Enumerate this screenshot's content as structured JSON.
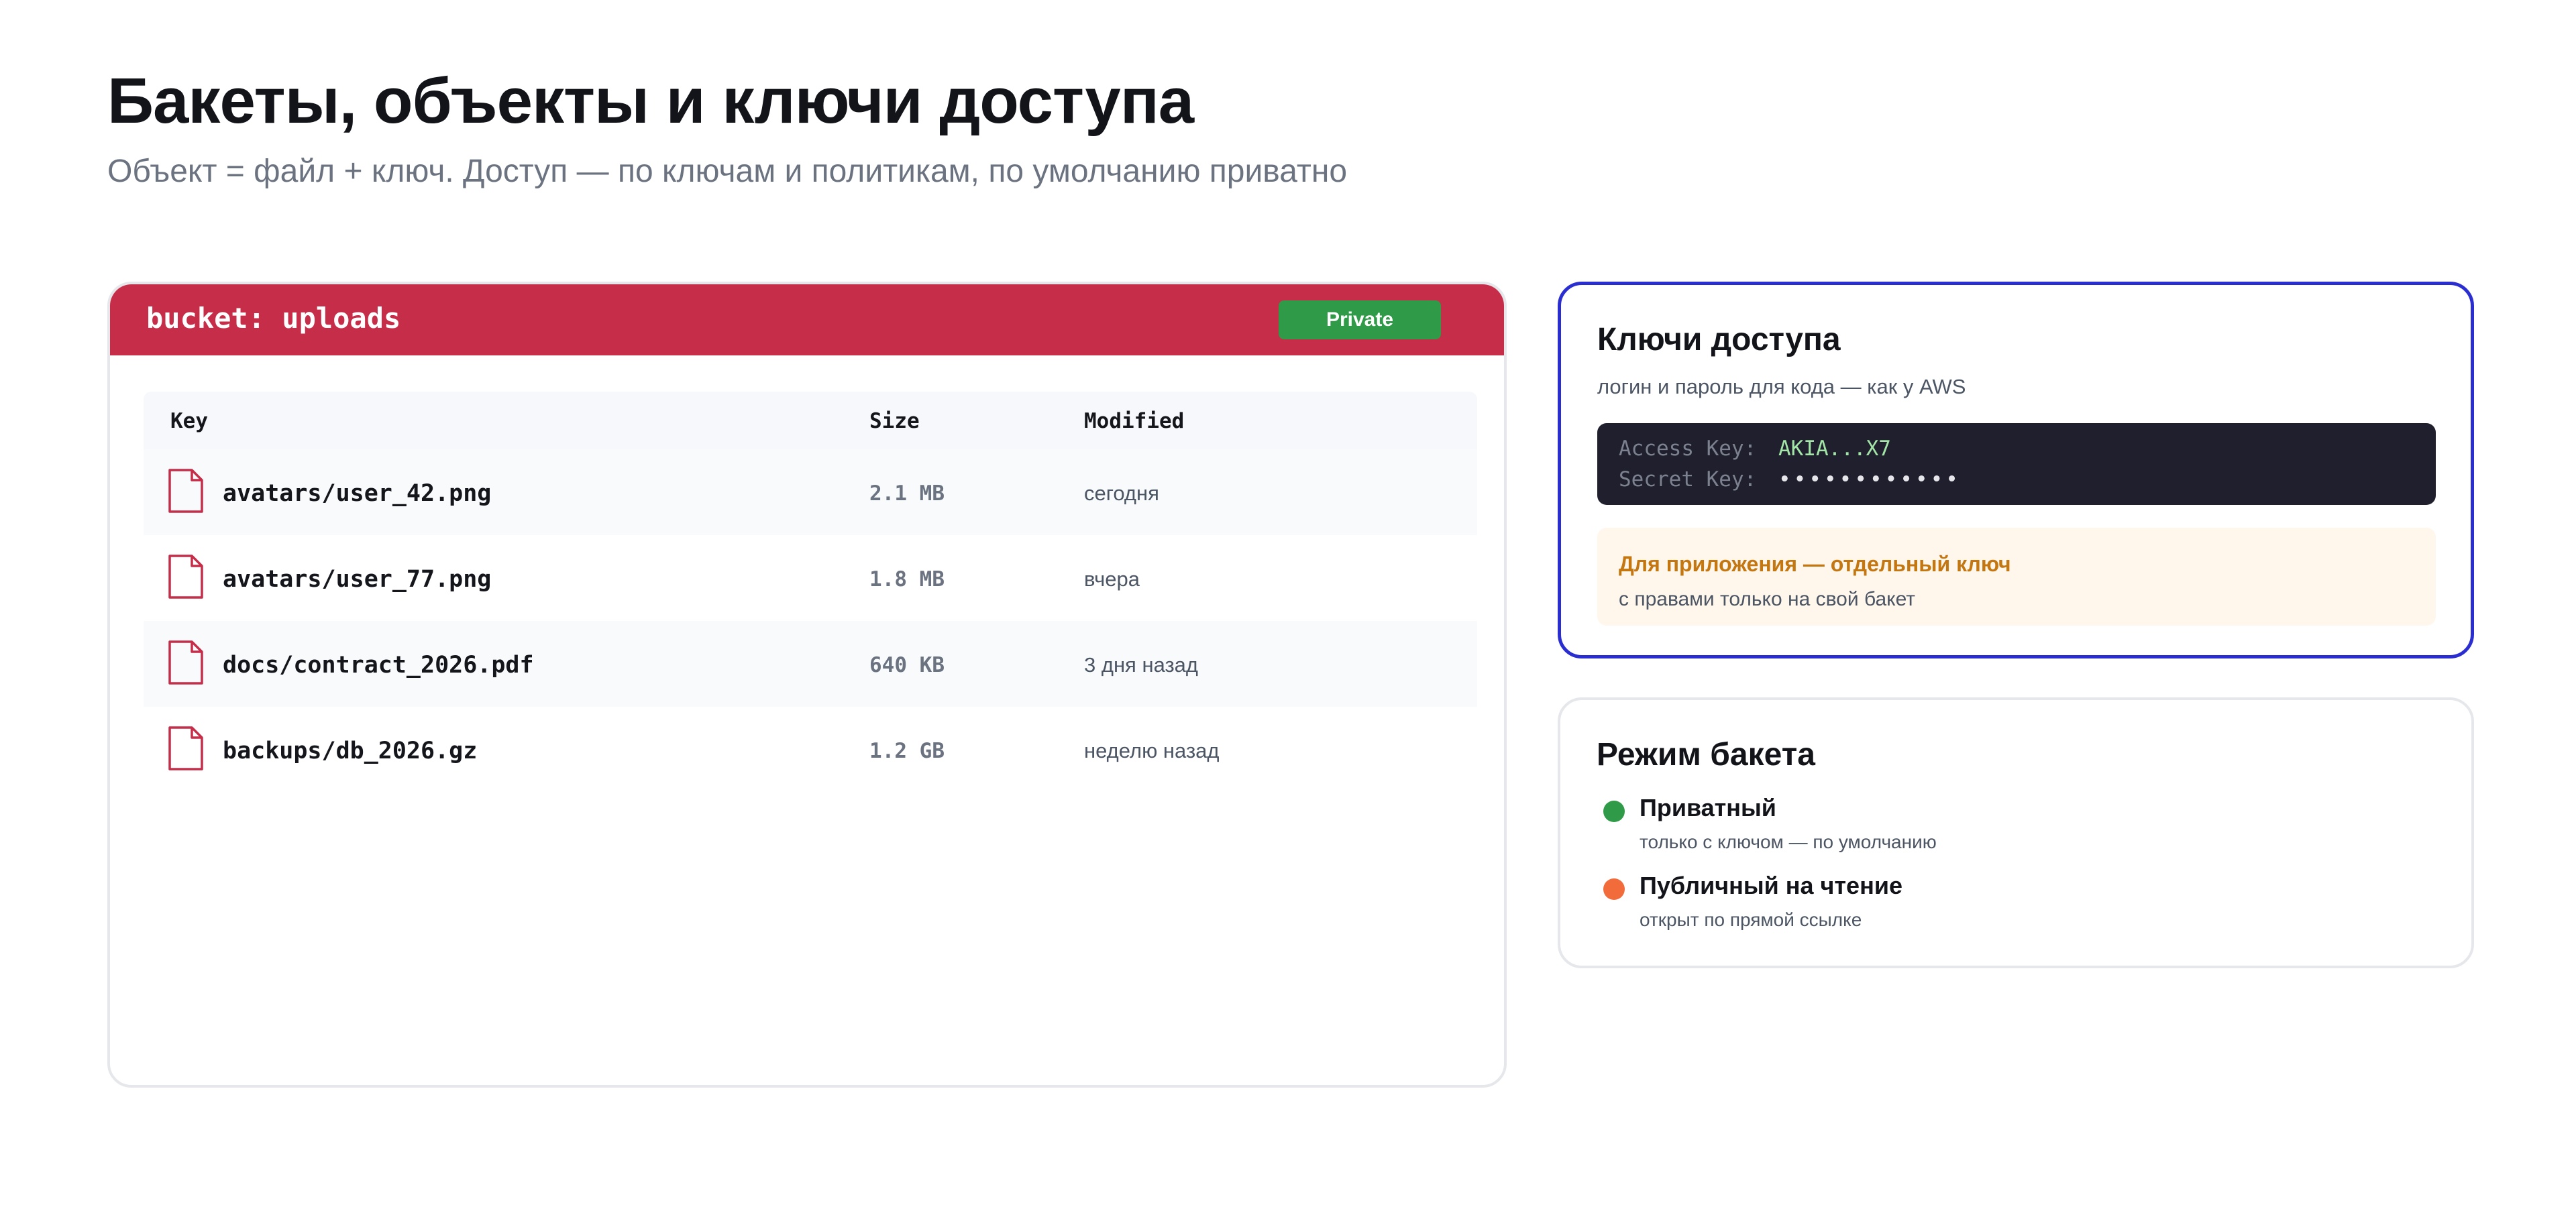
{
  "header": {
    "title": "Бакеты, объекты и ключи доступа",
    "subtitle": "Объект = файл + ключ. Доступ — по ключам и политикам, по умолчанию приватно"
  },
  "bucket": {
    "name": "bucket: uploads",
    "badge": "Private",
    "badge_color": "#2f9a47",
    "header_color": "#c62d49",
    "columns": {
      "key": "Key",
      "size": "Size",
      "modified": "Modified"
    },
    "files": [
      {
        "icon": "file-icon",
        "key": "avatars/user_42.png",
        "size": "2.1 MB",
        "modified": "сегодня"
      },
      {
        "icon": "file-icon",
        "key": "avatars/user_77.png",
        "size": "1.8 MB",
        "modified": "вчера"
      },
      {
        "icon": "file-icon",
        "key": "docs/contract_2026.pdf",
        "size": "640 KB",
        "modified": "3 дня назад"
      },
      {
        "icon": "file-icon",
        "key": "backups/db_2026.gz",
        "size": "1.2 GB",
        "modified": "неделю назад"
      }
    ]
  },
  "keys": {
    "title": "Ключи доступа",
    "subtitle": "логин и пароль для кода — как у AWS",
    "access_key_label": "Access Key:",
    "access_key_value": "AKIA...X7",
    "secret_key_label": "Secret Key:",
    "secret_key_value": "••••••••••••",
    "tip_title": "Для приложения — отдельный ключ",
    "tip_text": "с правами только на свой бакет",
    "border_color": "#2a2ed1"
  },
  "mode": {
    "title": "Режим бакета",
    "items": [
      {
        "label": "Приватный",
        "desc": "только с ключом — по умолчанию",
        "color": "#2f9a47"
      },
      {
        "label": "Публичный на чтение",
        "desc": "открыт по прямой ссылке",
        "color": "#f26b3a"
      }
    ]
  }
}
